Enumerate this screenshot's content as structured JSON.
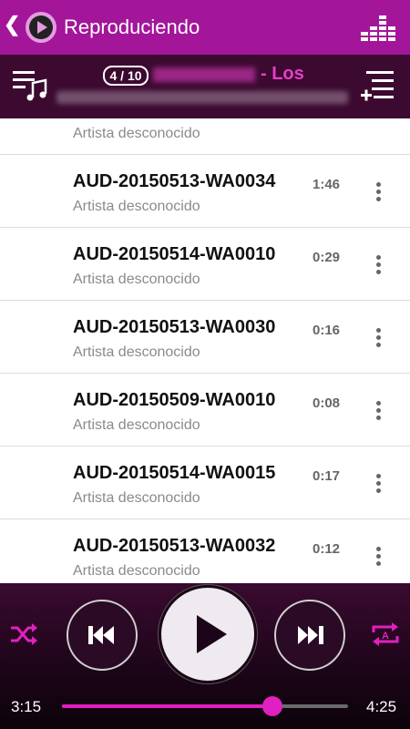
{
  "appbar": {
    "back_glyph": "❮",
    "title": "Reproduciendo"
  },
  "now_playing": {
    "track_count": "4 / 10",
    "title_visible": "- Los"
  },
  "tracks": [
    {
      "title": "",
      "artist": "Artista desconocido",
      "duration": ""
    },
    {
      "title": "AUD-20150513-WA0034",
      "artist": "Artista desconocido",
      "duration": "1:46"
    },
    {
      "title": "AUD-20150514-WA0010",
      "artist": "Artista desconocido",
      "duration": "0:29"
    },
    {
      "title": "AUD-20150513-WA0030",
      "artist": "Artista desconocido",
      "duration": "0:16"
    },
    {
      "title": "AUD-20150509-WA0010",
      "artist": "Artista desconocido",
      "duration": "0:08"
    },
    {
      "title": "AUD-20150514-WA0015",
      "artist": "Artista desconocido",
      "duration": "0:17"
    },
    {
      "title": "AUD-20150513-WA0032",
      "artist": "Artista desconocido",
      "duration": "0:12"
    }
  ],
  "player": {
    "current_time": "3:15",
    "total_time": "4:25",
    "progress": 0.736
  },
  "colors": {
    "accent": "#e020c0",
    "appbar": "#a3169a",
    "nowbar": "#3c0a31"
  },
  "icons": [
    "back-icon",
    "app-play-icon",
    "equalizer-icon",
    "queue-music-icon",
    "add-to-queue-icon",
    "more-vert-icon",
    "shuffle-icon",
    "previous-icon",
    "play-icon",
    "next-icon",
    "repeat-all-icon"
  ]
}
